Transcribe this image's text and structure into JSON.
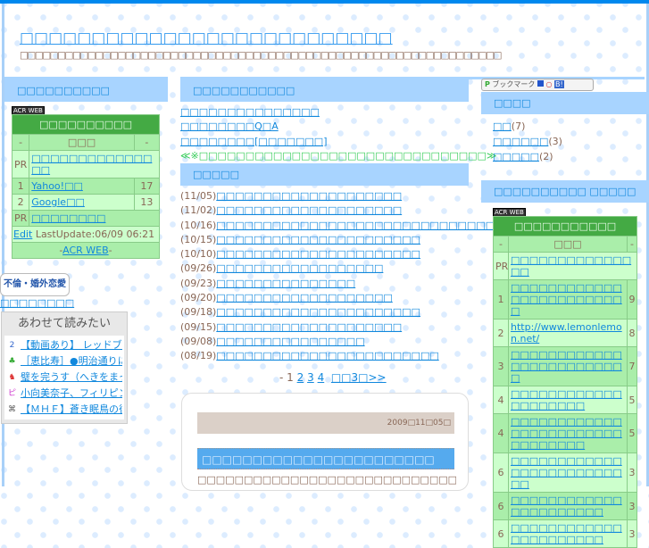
{
  "header": {
    "title": "□□□□□□□□□□□□□□□□□□□□□□□□□□",
    "subtitle": "□□□□□□□□□□□□□□□□□□□□□□□□□□□□□□□□□□□□□□□□□□□□□□□□□□□□□□□□□□□□□□□□"
  },
  "left": {
    "section_title": "□□□□□□□□□□",
    "acr_badge": "ACR WEB",
    "ranking": {
      "title": "□□□□□□□□□□",
      "col_dash": "-",
      "col_name": "□□□",
      "rows": [
        {
          "rank": "PR",
          "label": "□□□□□□□□□□□□□□□",
          "count": ""
        },
        {
          "rank": "1",
          "label": "Yahoo!□□",
          "count": "17"
        },
        {
          "rank": "2",
          "label": "Google□□",
          "count": "13"
        },
        {
          "rank": "PR",
          "label": "□□□□□□□□",
          "count": ""
        }
      ],
      "edit": "Edit",
      "last_update": "LastUpdate:06/09 06:21",
      "footer_link": "ACR WEB"
    },
    "ad_label": "不倫・婚外恋愛",
    "ad_link": "□□□□□□□□",
    "related": {
      "title": "あわせて読みたい",
      "items": [
        {
          "icon": "2",
          "text": "【動画あり】 レッドブル"
        },
        {
          "icon": "♣",
          "text": "［恵比寿］●明治通りに"
        },
        {
          "icon": "♞",
          "text": "璧を完うす（へきをまっと"
        },
        {
          "icon": "ピ",
          "text": "小向美奈子、フィリピン"
        },
        {
          "icon": "⌘",
          "text": "【ＭＨＦ】蒼き眠鳥の後"
        }
      ]
    }
  },
  "middle": {
    "section1_title": "□□□□□□□□□□□",
    "links": [
      "□□□□□□□□□□□□□□□",
      "□□□□□□□□Q□A",
      "□□□□□□□□[□□□□□□□]"
    ],
    "notice": "≪※□□□□□□□□□□□□□□□□□□□□□□□□□□□□□□□≫",
    "section2_title": "□□□□□",
    "posts": [
      {
        "date": "(11/05)",
        "title": "□□□□□□□□□□□□□□□□□□□□"
      },
      {
        "date": "(11/02)",
        "title": "□□□□□□□□□□□□□□□□□□□□"
      },
      {
        "date": "(10/16)",
        "title": "□□□□□□□□□□□□□□□□□□□□□□□□□□□□□□□□"
      },
      {
        "date": "(10/15)",
        "title": "□□□□□□□□□□□□□□□□□□□□□□"
      },
      {
        "date": "(10/10)",
        "title": "□□□□□□□□□□□□□□□□□□□□□□"
      },
      {
        "date": "(09/26)",
        "title": "□□□□□□□□□□□□□□□□□□"
      },
      {
        "date": "(09/23)",
        "title": "□□□□□□□□□□□□□□□"
      },
      {
        "date": "(09/20)",
        "title": "□□□□□□□□□□□□□□□□□□□"
      },
      {
        "date": "(09/18)",
        "title": "□□□□□□□□□□□□□□□□□□□□□□"
      },
      {
        "date": "(09/15)",
        "title": "□□□□□□□□□□□□□□□□□□□□"
      },
      {
        "date": "(09/08)",
        "title": "□□□□□□□□□□□□□□□□ "
      },
      {
        "date": "(08/19)",
        "title": "□□□□□□□□□□□□□□□□□□□□□□□□"
      }
    ],
    "pager": {
      "prefix": "- ",
      "current": "1",
      "pages": [
        "2",
        "3",
        "4"
      ],
      "next": "□□3□>>"
    },
    "entry": {
      "date": "2009□11□05□",
      "title": "□□□□□□□□□□□□□□□□□□□□□□□",
      "body": "□□□□□□□□□□□□□□□□□□□□□□□□□□□□□□□□□□□□□□□□□□□□"
    }
  },
  "right": {
    "bookmark_label": "ブックマーク",
    "categories_title": "□□□□",
    "categories": [
      {
        "label": "□□",
        "count": "(7)"
      },
      {
        "label": "□□□□□□",
        "count": "(3)"
      },
      {
        "label": "□□□□□",
        "count": "(2)"
      }
    ],
    "ranking_section_title": "□□□□□□□□□□ □□□□□",
    "acr_badge": "ACR WEB",
    "ranking": {
      "title": "□□□□□□□□□□□",
      "col_dash": "-",
      "col_name": "□□□",
      "rows": [
        {
          "rank": "PR",
          "label": "□□□□□□□□□□□□□□□",
          "count": ""
        },
        {
          "rank": "1",
          "label": "□□□□□□□□□□□□□□□□□□□□□□□□□",
          "count": "9"
        },
        {
          "rank": "2",
          "label": "http://www.lemonlemon.net/",
          "count": "8"
        },
        {
          "rank": "3",
          "label": "□□□□□□□□□□□□□□□□□□□□□□□□□",
          "count": "7"
        },
        {
          "rank": "4",
          "label": "□□□□□□□□□□□□□□□□□□□□",
          "count": "5"
        },
        {
          "rank": "4",
          "label": "□□□□□□□□□□□□□□□□□□□□□□□□□□□□□□□□",
          "count": "5"
        },
        {
          "rank": "6",
          "label": "□□□□□□□□□□□□□□□□□□□□□□□□□□",
          "count": "3"
        },
        {
          "rank": "6",
          "label": "□□□□□□□□□□□□□□□□□□□□□□",
          "count": "3"
        },
        {
          "rank": "6",
          "label": "□□□□□□□□□□□□□□□□□□□□□□",
          "count": "3"
        }
      ]
    }
  }
}
